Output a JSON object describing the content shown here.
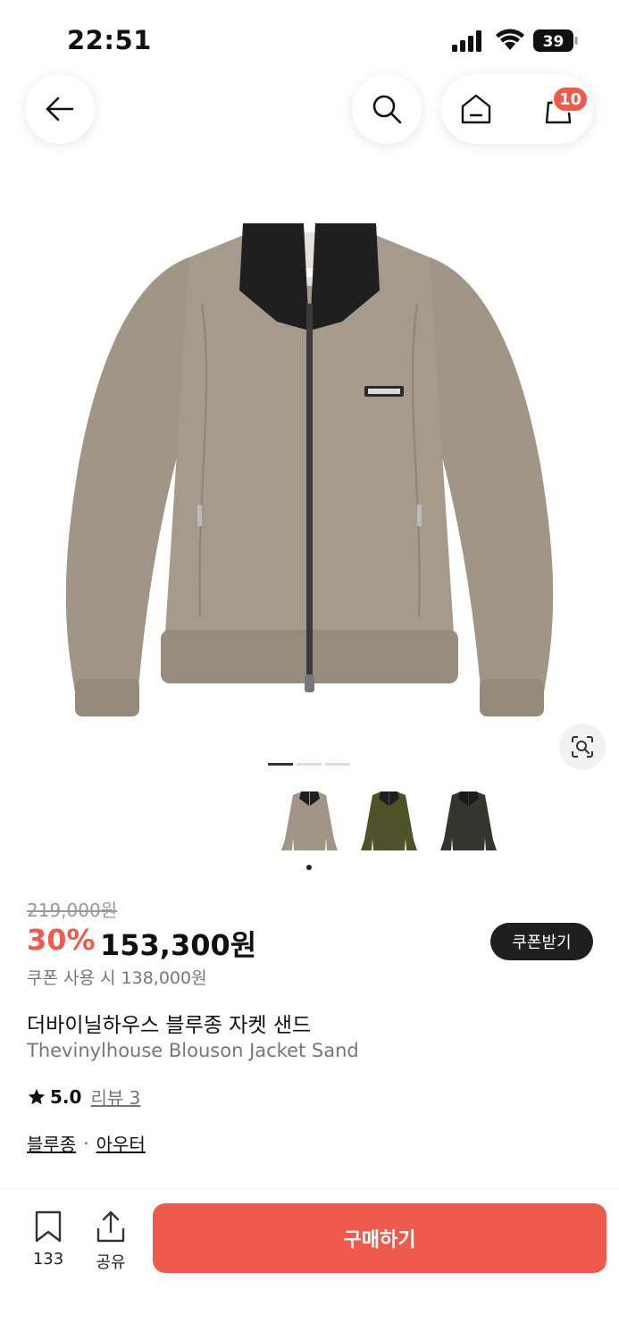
{
  "status_bar": {
    "time": "22:51",
    "battery": "39"
  },
  "top_bar": {
    "cart_count": "10"
  },
  "gallery": {
    "pages": 3,
    "active_page": 1,
    "thumbnails": [
      "sand",
      "khaki",
      "charcoal"
    ]
  },
  "product": {
    "original_price": "219,000원",
    "discount": "30%",
    "sale_price": "153,300원",
    "coupon_button": "쿠폰받기",
    "coupon_price": "쿠폰 사용 시 138,000원",
    "title_ko": "더바이닐하우스 블루종 자켓 샌드",
    "title_en": "Thevinylhouse Blouson Jacket Sand",
    "rating": "5.0",
    "review": "리뷰 3",
    "category_1": "블루종",
    "separator": "·",
    "category_2": "아우터"
  },
  "bottom_bar": {
    "bookmark_count": "133",
    "share_label": "공유",
    "buy_label": "구매하기"
  },
  "colors": {
    "accent": "#ef5a4a",
    "jacket_sand": "#a09586",
    "jacket_khaki": "#4e5228",
    "jacket_charcoal": "#34352c"
  }
}
